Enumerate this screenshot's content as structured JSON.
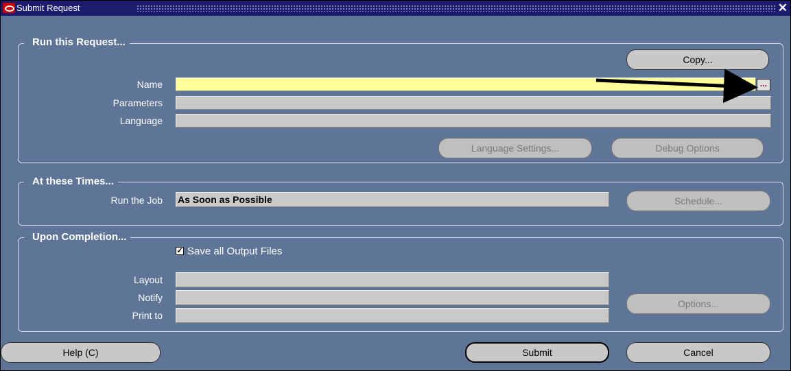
{
  "window": {
    "title": "Submit Request",
    "close_glyph": "✕"
  },
  "run_request": {
    "group_title": "Run this Request...",
    "copy_label": "Copy...",
    "name_label": "Name",
    "name_value": "",
    "lov_label": "...",
    "parameters_label": "Parameters",
    "parameters_value": "",
    "language_label": "Language",
    "language_value": "",
    "language_settings_label": "Language Settings...",
    "debug_options_label": "Debug Options"
  },
  "times": {
    "group_title": "At these Times...",
    "run_job_label": "Run the Job",
    "run_job_value": "As Soon as Possible",
    "schedule_label": "Schedule..."
  },
  "completion": {
    "group_title": "Upon Completion...",
    "save_output_label": "Save all Output Files",
    "save_output_checked": true,
    "layout_label": "Layout",
    "layout_value": "",
    "notify_label": "Notify",
    "notify_value": "",
    "print_to_label": "Print to",
    "print_to_value": "",
    "options_label": "Options..."
  },
  "footer": {
    "help_label": "Help (C)",
    "submit_label": "Submit",
    "cancel_label": "Cancel"
  },
  "colors": {
    "window_bg": "#5f7597",
    "titlebar": "#1c1c6e",
    "required_field": "#ffff99",
    "field_bg": "#c9c9c9"
  },
  "icons": [
    "oracle-forms-icon",
    "close-icon",
    "arrow-annotation",
    "checkbox-checked-icon"
  ]
}
